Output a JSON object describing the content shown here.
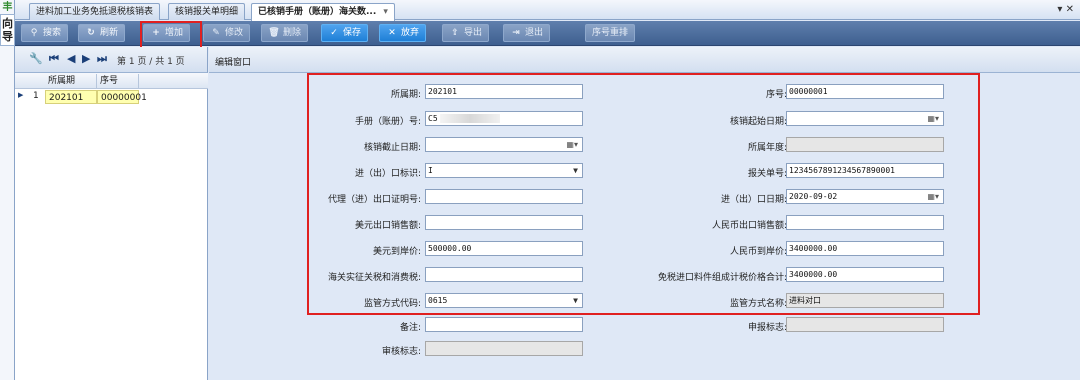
{
  "nav_strip": {
    "pin_icon": "pin-icon",
    "text_1": "向",
    "text_2": "导"
  },
  "tabs": [
    {
      "label": "进料加工业务免抵退税核销表"
    },
    {
      "label": "核销报关单明细"
    },
    {
      "label": "已核销手册（账册）海关数..."
    }
  ],
  "tabbar_controls": "▾ ✕",
  "toolbar": {
    "search_label": "搜索",
    "refresh_label": "刷新",
    "add_label": "增加",
    "edit_label": "修改",
    "delete_label": "删除",
    "save_label": "保存",
    "discard_label": "放弃",
    "export_label": "导出",
    "exit_label": "退出",
    "reorder_label": "序号重排"
  },
  "pager": {
    "text": "第 1 页 / 共 1 页"
  },
  "editor_title": "编辑窗口",
  "grid": {
    "columns": [
      "所属期",
      "序号"
    ],
    "rows": [
      {
        "num": "1",
        "period": "202101",
        "seq": "00000001"
      }
    ]
  },
  "form": {
    "period_label": "所属期:",
    "period_value": "202101",
    "seq_label": "序号:",
    "seq_value": "00000001",
    "manual_label": "手册（账册）号:",
    "manual_value": "C5",
    "start_date_label": "核销起始日期:",
    "start_date_value": "",
    "end_date_label": "核销截止日期:",
    "end_date_value": "",
    "year_label": "所属年度:",
    "year_value": "",
    "io_flag_label": "进（出）口标识:",
    "io_flag_value": "I",
    "customs_no_label": "报关单号:",
    "customs_no_value": "1234567891234567890001",
    "agent_cert_label": "代理（进）出口证明号:",
    "agent_cert_value": "",
    "io_date_label": "进（出）口日期:",
    "io_date_value": "2020-09-02",
    "usd_sales_label": "美元出口销售额:",
    "usd_sales_value": "",
    "rmb_sales_label": "人民币出口销售额:",
    "rmb_sales_value": "",
    "usd_cif_label": "美元到岸价:",
    "usd_cif_value": "500000.00",
    "rmb_cif_label": "人民币到岸价:",
    "rmb_cif_value": "3400000.00",
    "tax_label": "海关实征关税和消费税:",
    "tax_value": "",
    "dutyfree_label": "免税进口料件组成计税价格合计:",
    "dutyfree_value": "3400000.00",
    "supervise_code_label": "监管方式代码:",
    "supervise_code_value": "0615",
    "supervise_name_label": "监管方式名称:",
    "supervise_name_value": "进料对口",
    "remark_label": "备注:",
    "remark_value": "",
    "declare_flag_label": "申报标志:",
    "declare_flag_value": "",
    "audit_flag_label": "审核标志:",
    "audit_flag_value": ""
  },
  "colors": {
    "toolbar": "#4a6a9a",
    "highlight": "#e02020",
    "selected_row": "#ffffb0"
  }
}
